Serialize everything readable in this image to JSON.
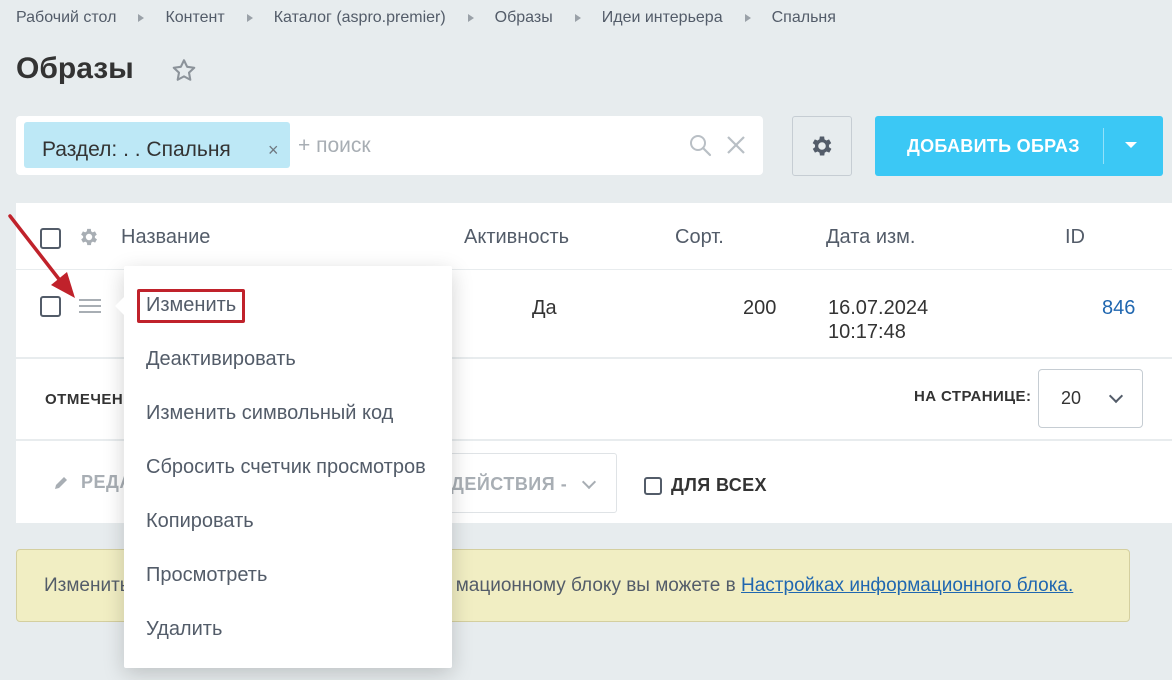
{
  "breadcrumb": [
    "Рабочий стол",
    "Контент",
    "Каталог (aspro.premier)",
    "Образы",
    "Идеи интерьера",
    "Спальня"
  ],
  "page": {
    "title": "Образы"
  },
  "filter": {
    "chip_label": "Раздел: . . Спальня",
    "chip_remove": "×",
    "search_placeholder": "+ поиск"
  },
  "toolbar": {
    "add_label": "ДОБАВИТЬ ОБРАЗ"
  },
  "grid": {
    "columns": {
      "name": "Название",
      "active": "Активность",
      "sort": "Сорт.",
      "date": "Дата изм.",
      "id": "ID"
    },
    "rows": [
      {
        "active": "Да",
        "sort": "200",
        "date_line1": "16.07.2024",
        "date_line2": "10:17:48",
        "id": "846"
      }
    ]
  },
  "footer": {
    "marked_label": "ОТМЕЧЕН",
    "per_page_label": "НА СТРАНИЦЕ:",
    "per_page_value": "20"
  },
  "actions": {
    "edit_label": "РЕДА",
    "actions_label": "ДЕЙСТВИЯ -",
    "for_all_label": "ДЛЯ ВСЕХ"
  },
  "notice": {
    "text_prefix": "Изменить",
    "text_middle": "мационному блоку вы можете в ",
    "link": "Настройках информационного блока."
  },
  "context_menu": {
    "items": [
      "Изменить",
      "Деактивировать",
      "Изменить символьный код",
      "Сбросить счетчик просмотров",
      "Копировать",
      "Просмотреть",
      "Удалить"
    ]
  },
  "colors": {
    "accent": "#3bc8f5",
    "chip": "#bde8f6",
    "highlight": "#c0222b",
    "link": "#2067b0",
    "notice_bg": "#f1eec3"
  }
}
